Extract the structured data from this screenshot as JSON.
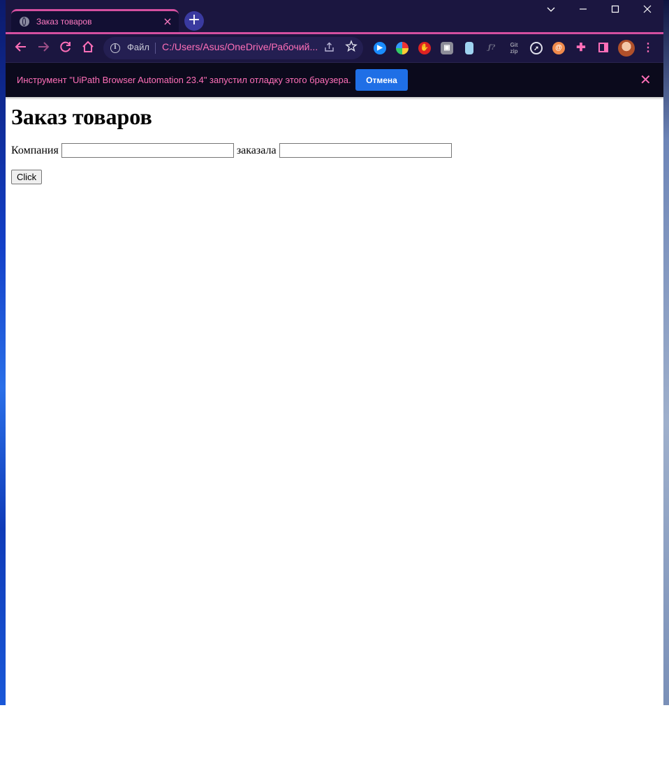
{
  "browser": {
    "tab": {
      "title": "Заказ товаров",
      "icon": "globe-icon"
    },
    "new_tab_symbol": "+",
    "window_controls": {
      "tab_search": "⌄",
      "minimize": "—",
      "maximize": "□",
      "close": "✕"
    },
    "address": {
      "label": "Файл",
      "url": "C:/Users/Asus/OneDrive/Рабочий..."
    },
    "extensions": [
      "video-icon",
      "colorpicker-icon",
      "stop-icon",
      "photo-icon",
      "cast-icon",
      "fx-icon",
      "gitzip-icon",
      "compass-icon",
      "spiral-icon",
      "puzzle-icon",
      "sidepanel-icon",
      "profile-avatar",
      "menu-icon"
    ],
    "extension_labels": {
      "fx": "ƒ?",
      "gitzip": "Git\nzip"
    },
    "accent_color": "#ff6fb8",
    "frame_color": "#1b1640"
  },
  "infobar": {
    "message": "Инструмент \"UiPath Browser Automation 23.4\" запустил отладку этого браузера.",
    "cancel_label": "Отмена"
  },
  "page": {
    "heading": "Заказ товаров",
    "company_label": "Компания",
    "company_value": "",
    "ordered_label": "заказала",
    "ordered_value": "",
    "button_label": "Click"
  }
}
